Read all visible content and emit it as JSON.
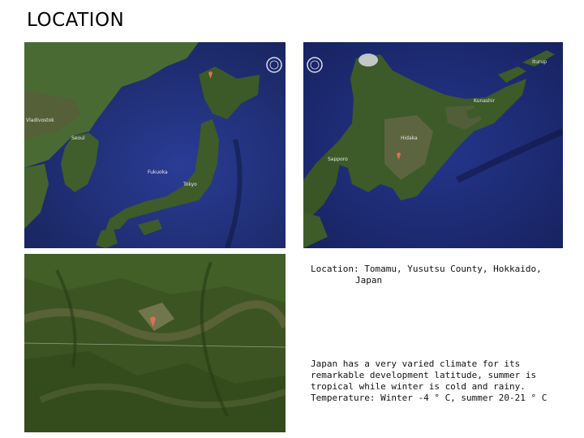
{
  "slide": {
    "title": "LOCATION"
  },
  "maps": {
    "japan": {
      "labels": {
        "seoul": "Seoul",
        "fukuoka": "Fukuoka",
        "tokyo": "Tokyo",
        "vladivostok": "Vladivostok"
      }
    },
    "hokkaido": {
      "labels": {
        "sapporo": "Sapporo",
        "hidaka": "Hidaka",
        "kunashir": "Kunashir",
        "iturup": "Iturup"
      }
    }
  },
  "location": {
    "line1": "Location: Tomamu, Yusutsu County, Hokkaido,",
    "line2": "Japan"
  },
  "climate": {
    "line1": "Japan has a very varied climate for its",
    "line2": "remarkable development latitude, summer is",
    "line3": "tropical while winter is cold and rainy.",
    "line4": "Temperature:  Winter -4 ° C, summer 20-21 ° C"
  },
  "colors": {
    "ocean_dark": "#1b2a6b",
    "ocean_mid": "#24358a",
    "land_green": "#3e5a2a",
    "land_dark": "#2b3f1e",
    "land_brown": "#6b6a4a",
    "marker": "#e07050"
  }
}
